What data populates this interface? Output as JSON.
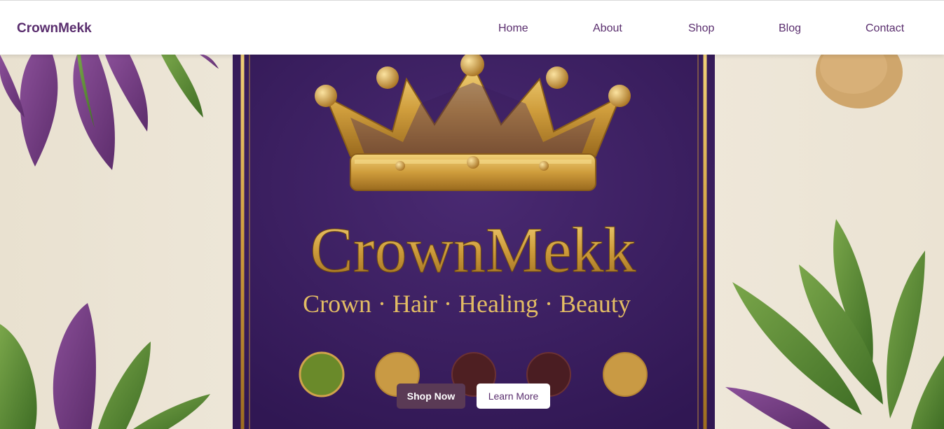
{
  "header": {
    "brand": "CrownMekk",
    "nav": [
      "Home",
      "About",
      "Shop",
      "Blog",
      "Contact"
    ]
  },
  "hero": {
    "title": "CrownMekk",
    "tagline": "Crown · Hair · Healing · Beauty",
    "primary_cta": "Shop Now",
    "secondary_cta": "Learn More"
  },
  "colors": {
    "brand_purple": "#5a2e6e",
    "panel_purple": "#3e1f63",
    "gold": "#d4a84a",
    "background": "#efe8da",
    "primary_button": "#5a3a55"
  },
  "icons": [
    "crown-icon",
    "leaf-icon"
  ]
}
